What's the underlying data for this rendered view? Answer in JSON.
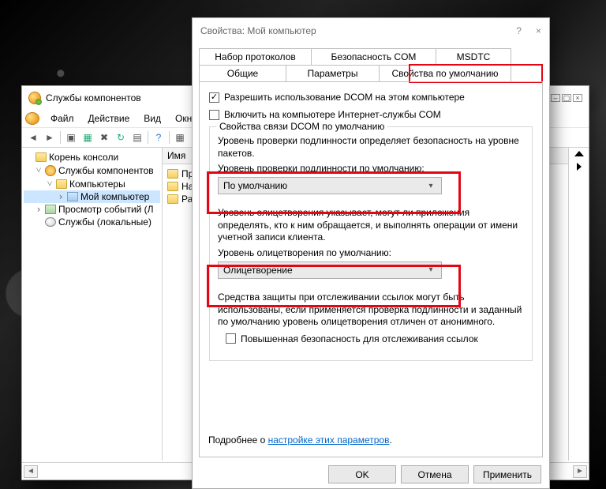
{
  "comp": {
    "title": "Службы компонентов",
    "menu": {
      "file": "Файл",
      "action": "Действие",
      "view": "Вид",
      "window": "Окно"
    },
    "tree": {
      "root": "Корень консоли",
      "services": "Службы компонентов",
      "computers": "Компьютеры",
      "mycomputer": "Мой компьютер",
      "eventlog": "Просмотр событий (Л",
      "localsvc": "Службы (локальные)"
    },
    "list": {
      "header": "Имя",
      "items": [
        "Пр",
        "На",
        "Ра"
      ]
    }
  },
  "prop": {
    "title": "Свойства: Мой компьютер",
    "tabs": {
      "protocols": "Набор протоколов",
      "comsec": "Безопасность COM",
      "msdtc": "MSDTC",
      "general": "Общие",
      "params": "Параметры",
      "defaults": "Свойства по умолчанию"
    },
    "chk_dcom": "Разрешить использование DCOM на этом компьютере",
    "chk_inet": "Включить на компьютере Интернет-службы COM",
    "group_legend": "Свойства связи DCOM по умолчанию",
    "auth_desc": "Уровень проверки подлинности определяет безопасность на уровне пакетов.",
    "auth_label": "Уровень проверки подлинности по умолчанию:",
    "auth_value": "По умолчанию",
    "imp_desc": "Уровень олицетворения указывает, могут ли приложения определять, кто к ним обращается, и выполнять операции от имени учетной записи клиента.",
    "imp_label": "Уровень олицетворения по умолчанию:",
    "imp_value": "Олицетворение",
    "track_desc": "Средства защиты при отслеживании ссылок могут быть использованы, если применяется проверка подлинности и заданный по умолчанию уровень олицетворения отличен от анонимного.",
    "chk_track": "Повышенная безопасность для отслеживания ссылок",
    "more_pre": "Подробнее о ",
    "more_link": "настройке этих параметров",
    "btn_ok": "OK",
    "btn_cancel": "Отмена",
    "btn_apply": "Применить"
  }
}
